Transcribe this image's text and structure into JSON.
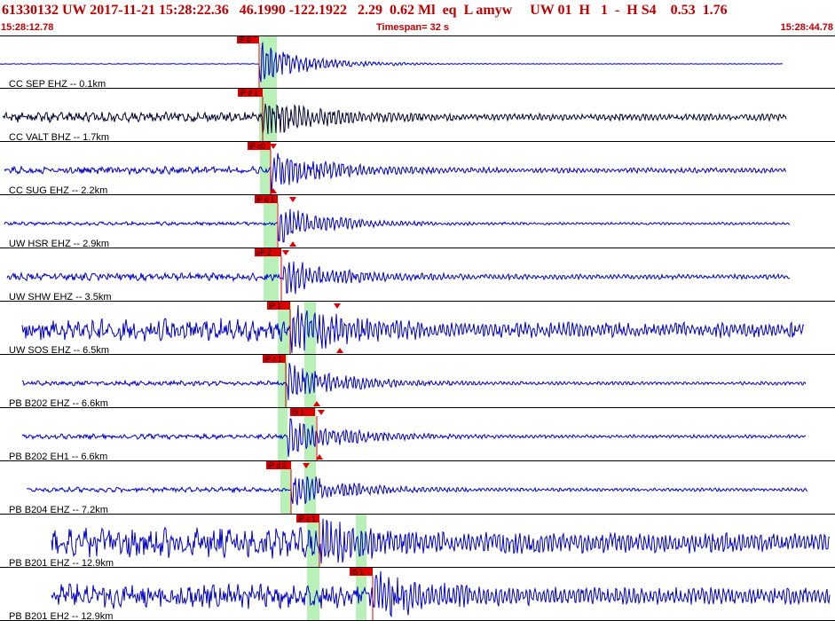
{
  "header": {
    "title_line": "61330132 UW 2017-11-21 15:28:22.36   46.1990 -122.1922   2.29  0.62 Ml  eq  L amyw     UW 01  H   1  -  H S4    0.53  1.76",
    "start_time": "15:28:12.78",
    "timespan": "Timespan=  32 s",
    "end_time": "15:28:44.78"
  },
  "colors": {
    "trace_primary": "#0000cc",
    "trace_dark": "#000033",
    "pick_flag": "#dd0000",
    "pick_window": "#b8f0b8",
    "header_text": "#c00000"
  },
  "traces": [
    {
      "label": "CC SEP EHZ --  0.1km",
      "picks": [
        {
          "label": "iP 0"
        }
      ]
    },
    {
      "label": "CC VALT BHZ --  1.7km",
      "picks": [
        {
          "label": "iP d 1"
        }
      ]
    },
    {
      "label": "CC SUG EHZ --  2.2km",
      "picks": [
        {
          "label": "iP c0"
        }
      ]
    },
    {
      "label": "UW HSR EHZ --  2.9km",
      "picks": [
        {
          "label": "iP d 1"
        }
      ]
    },
    {
      "label": "UW SHW EHZ --  3.5km",
      "picks": [
        {
          "label": "eP  2"
        }
      ]
    },
    {
      "label": "UW SOS EHZ --  6.5km",
      "picks": [
        {
          "label": "iP  1"
        }
      ]
    },
    {
      "label": "PB B202 EHZ --  6.6km",
      "picks": [
        {
          "label": "iP c 1"
        }
      ]
    },
    {
      "label": "PB B202 EH1 --  6.6km",
      "picks": [
        {
          "label": "iS  1"
        }
      ]
    },
    {
      "label": "PB B204 EHZ --  7.2km",
      "picks": [
        {
          "label": "iP d 0"
        }
      ]
    },
    {
      "label": "PB B201 EHZ --  12.9km",
      "picks": [
        {
          "label": "iP c 1"
        }
      ]
    },
    {
      "label": "PB B201 EH2 --  12.9km",
      "picks": [
        {
          "label": "iS  1"
        }
      ]
    }
  ]
}
